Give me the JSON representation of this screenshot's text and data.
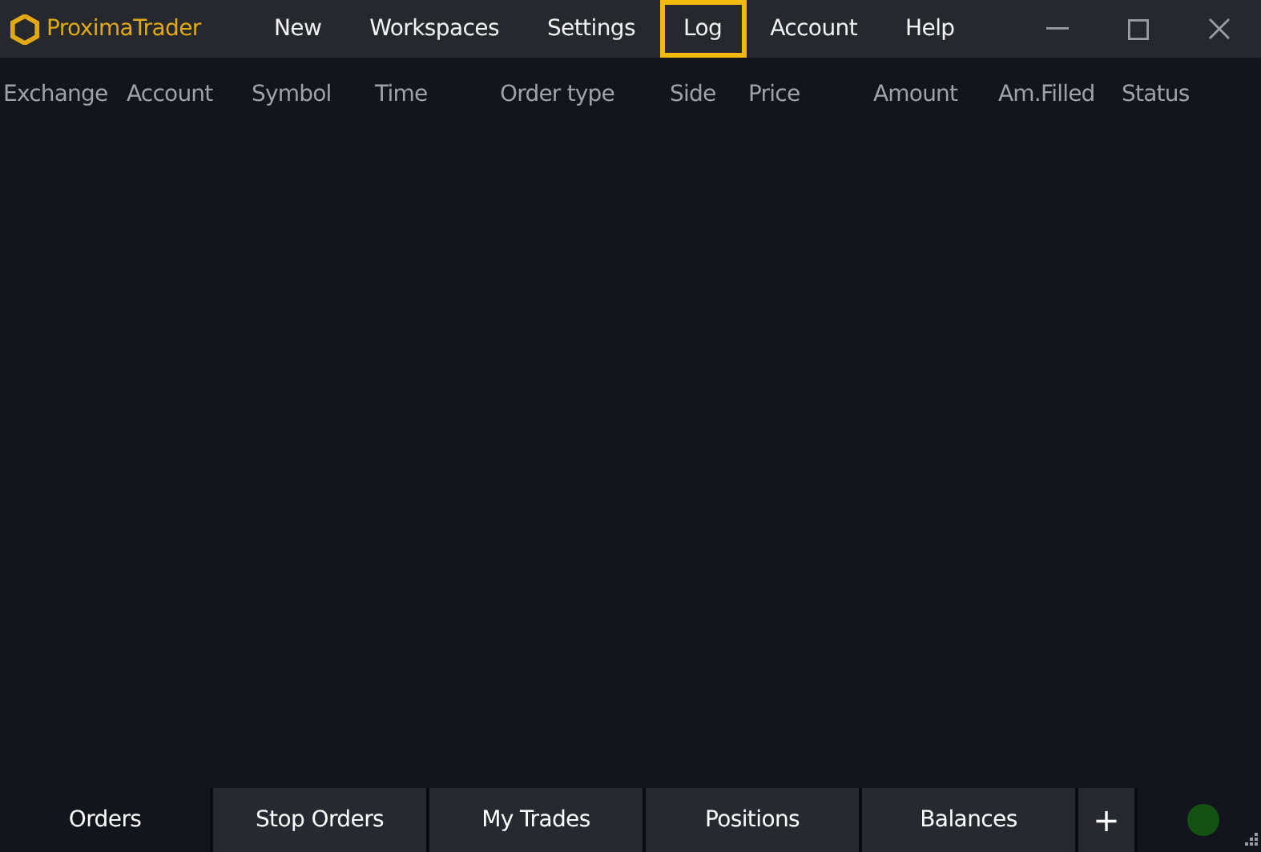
{
  "app": {
    "name": "ProximaTrader"
  },
  "menu": [
    {
      "label": "New",
      "highlighted": false
    },
    {
      "label": "Workspaces",
      "highlighted": false
    },
    {
      "label": "Settings",
      "highlighted": false
    },
    {
      "label": "Log",
      "highlighted": true
    },
    {
      "label": "Account",
      "highlighted": false
    },
    {
      "label": "Help",
      "highlighted": false
    }
  ],
  "table": {
    "columns": [
      "Exchange",
      "Account",
      "Symbol",
      "Time",
      "Order type",
      "Side",
      "Price",
      "Amount",
      "Am.Filled",
      "Status"
    ]
  },
  "tabs": [
    {
      "label": "Orders",
      "selected": true
    },
    {
      "label": "Stop Orders",
      "selected": false
    },
    {
      "label": "My Trades",
      "selected": false
    },
    {
      "label": "Positions",
      "selected": false
    },
    {
      "label": "Balances",
      "selected": false
    }
  ],
  "add_tab": {
    "label": "+"
  },
  "status": {
    "color": "#145214"
  }
}
